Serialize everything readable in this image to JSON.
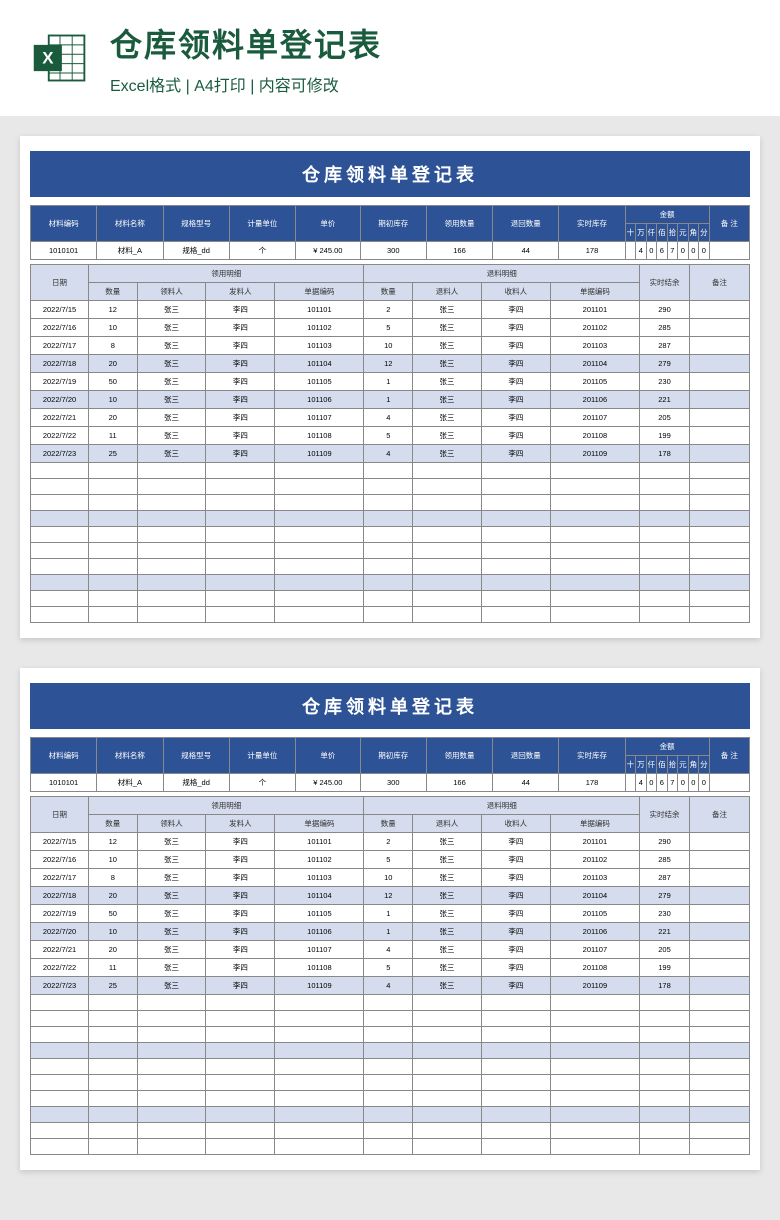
{
  "header": {
    "main_title": "仓库领料单登记表",
    "sub_title": "Excel格式 | A4打印 | 内容可修改"
  },
  "sheet_title": "仓库领料单登记表",
  "info_headers": {
    "material_code": "材料编码",
    "material_name": "材料名称",
    "spec": "规格型号",
    "unit": "计量单位",
    "price": "单价",
    "initial_stock": "期初库存",
    "issue_qty": "领用数量",
    "return_qty": "退回数量",
    "real_stock": "实时库存",
    "amount": "金额",
    "remark": "备 注"
  },
  "amount_units": [
    "十",
    "万",
    "仟",
    "佰",
    "拾",
    "元",
    "角",
    "分"
  ],
  "info_row": {
    "material_code": "1010101",
    "material_name": "材料_A",
    "spec": "规格_dd",
    "unit": "个",
    "price": "¥   245.00",
    "initial_stock": "300",
    "issue_qty": "166",
    "return_qty": "44",
    "real_stock": "178",
    "amount_digits": [
      "",
      "4",
      "0",
      "6",
      "7",
      "0",
      "0",
      "0"
    ],
    "remark": ""
  },
  "detail_headers": {
    "date": "日期",
    "issue_group": "领用明细",
    "return_group": "退料明细",
    "balance": "实时结余",
    "remark": "备注",
    "qty": "数量",
    "issuer": "领料人",
    "sender": "发料人",
    "doc_no": "单据编码",
    "returner": "退料人",
    "receiver": "收料人"
  },
  "rows": [
    {
      "date": "2022/7/15",
      "iq": "12",
      "ip": "张三",
      "is": "李四",
      "ino": "101101",
      "rq": "2",
      "rp": "张三",
      "rr": "李四",
      "rno": "201101",
      "bal": "290",
      "alt": false
    },
    {
      "date": "2022/7/16",
      "iq": "10",
      "ip": "张三",
      "is": "李四",
      "ino": "101102",
      "rq": "5",
      "rp": "张三",
      "rr": "李四",
      "rno": "201102",
      "bal": "285",
      "alt": false
    },
    {
      "date": "2022/7/17",
      "iq": "8",
      "ip": "张三",
      "is": "李四",
      "ino": "101103",
      "rq": "10",
      "rp": "张三",
      "rr": "李四",
      "rno": "201103",
      "bal": "287",
      "alt": false
    },
    {
      "date": "2022/7/18",
      "iq": "20",
      "ip": "张三",
      "is": "李四",
      "ino": "101104",
      "rq": "12",
      "rp": "张三",
      "rr": "李四",
      "rno": "201104",
      "bal": "279",
      "alt": true
    },
    {
      "date": "2022/7/19",
      "iq": "50",
      "ip": "张三",
      "is": "李四",
      "ino": "101105",
      "rq": "1",
      "rp": "张三",
      "rr": "李四",
      "rno": "201105",
      "bal": "230",
      "alt": false
    },
    {
      "date": "2022/7/20",
      "iq": "10",
      "ip": "张三",
      "is": "李四",
      "ino": "101106",
      "rq": "1",
      "rp": "张三",
      "rr": "李四",
      "rno": "201106",
      "bal": "221",
      "alt": true
    },
    {
      "date": "2022/7/21",
      "iq": "20",
      "ip": "张三",
      "is": "李四",
      "ino": "101107",
      "rq": "4",
      "rp": "张三",
      "rr": "李四",
      "rno": "201107",
      "bal": "205",
      "alt": false
    },
    {
      "date": "2022/7/22",
      "iq": "11",
      "ip": "张三",
      "is": "李四",
      "ino": "101108",
      "rq": "5",
      "rp": "张三",
      "rr": "李四",
      "rno": "201108",
      "bal": "199",
      "alt": false
    },
    {
      "date": "2022/7/23",
      "iq": "25",
      "ip": "张三",
      "is": "李四",
      "ino": "101109",
      "rq": "4",
      "rp": "张三",
      "rr": "李四",
      "rno": "201109",
      "bal": "178",
      "alt": true
    }
  ],
  "empty_rows": 10
}
